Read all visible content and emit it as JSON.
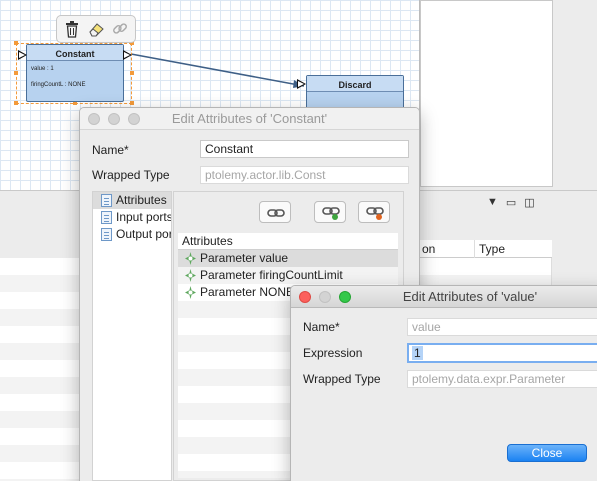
{
  "canvas": {
    "actors": [
      {
        "title": "Constant",
        "params": [
          "value : 1",
          "firingCountL : NONE"
        ]
      },
      {
        "title": "Discard"
      }
    ],
    "toolbar_icons": [
      "trash-icon",
      "eraser-icon",
      "link-icon"
    ]
  },
  "table_panel": {
    "columns": [
      "on",
      "Type"
    ]
  },
  "edit_window": {
    "title": "Edit Attributes of 'Constant'",
    "name_label": "Name*",
    "name_value": "Constant",
    "wrapped_label": "Wrapped Type",
    "wrapped_value": "ptolemy.actor.lib.Const",
    "tree_items": [
      "Attributes",
      "Input ports",
      "Output ports"
    ],
    "list_header": "Attributes",
    "attributes": [
      "Parameter value",
      "Parameter firingCountLimit",
      "Parameter NONE"
    ]
  },
  "value_window": {
    "title": "Edit Attributes of 'value'",
    "name_label": "Name*",
    "name_value": "value",
    "expression_label": "Expression",
    "expression_value": "1",
    "wrapped_label": "Wrapped Type",
    "wrapped_value": "ptolemy.data.expr.Parameter",
    "close_label": "Close"
  },
  "colors": {
    "actor_fill": "#b7d2ef",
    "selection": "#f39a3a",
    "accent_button": "#1b82f2"
  }
}
